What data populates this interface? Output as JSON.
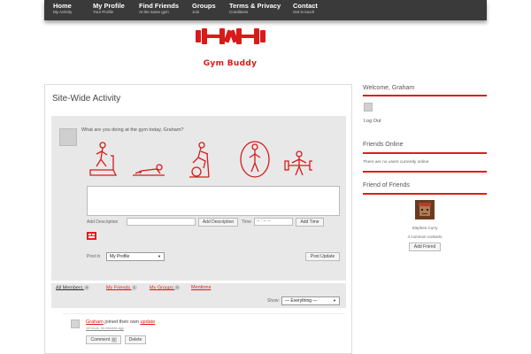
{
  "nav": {
    "items": [
      {
        "title": "Home",
        "sub": "My Activity"
      },
      {
        "title": "My Profile",
        "sub": "Your Profile"
      },
      {
        "title": "Find Friends",
        "sub": "At the same gym"
      },
      {
        "title": "Groups",
        "sub": "Join"
      },
      {
        "title": "Terms & Privacy",
        "sub": "Conditions"
      },
      {
        "title": "Contact",
        "sub": "Get in touch"
      }
    ]
  },
  "logo": {
    "text": "Gym Buddy"
  },
  "main": {
    "title": "Site-Wide Activity",
    "prompt": "What are you doing at the gym today, Graham?",
    "add_description_label": "Add Description",
    "add_description_button": "Add Description",
    "time_label": "Time",
    "time_placeholder": "-- : -- --",
    "add_time_button": "Add Time",
    "post_in_label": "Post in",
    "post_in_value": "My Profile",
    "post_update_button": "Post Update",
    "tabs": [
      {
        "label": "All Members",
        "count": "4"
      },
      {
        "label": "My Friends",
        "count": "1"
      },
      {
        "label": "My Groups",
        "count": "0"
      },
      {
        "label": "Mentions",
        "count": ""
      }
    ],
    "show_label": "Show:",
    "show_value": "— Everything —",
    "activity": {
      "user": "Graham",
      "action": " joined their own ",
      "link": "update",
      "meta": "16 hours, 54 minutes ago",
      "comment_button": "Comment",
      "comment_count": "0",
      "delete_button": "Delete"
    }
  },
  "sidebar": {
    "welcome_title": "Welcome, Graham",
    "logout_link": "Log Out",
    "friends_online_title": "Friends Online",
    "friends_online_note": "There are no users currently online",
    "fof_title": "Friend of Friends",
    "fof_name": "Stephen Curry",
    "fof_common": "4 common contacts",
    "add_friend_button": "Add Friend"
  },
  "colors": {
    "accent": "#e01d1d",
    "nav_bg": "#3a3a3a",
    "panel_bg": "#e8e8e8"
  }
}
